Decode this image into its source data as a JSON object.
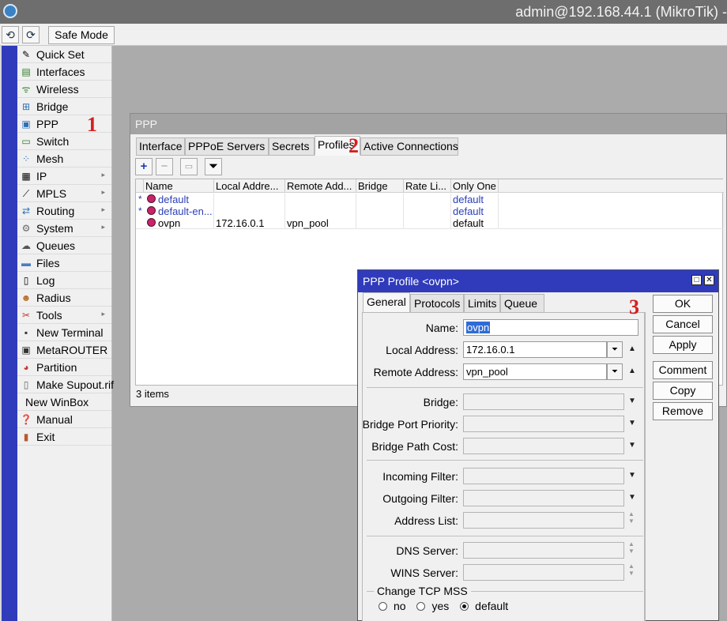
{
  "window": {
    "title": "admin@192.168.44.1 (MikroTik) -"
  },
  "toolbar": {
    "undo_icon": "undo-icon",
    "redo_icon": "redo-icon",
    "safe_mode": "Safe Mode"
  },
  "sidebar": {
    "items": [
      {
        "label": "Quick Set",
        "icon": "wand-icon"
      },
      {
        "label": "Interfaces",
        "icon": "interfaces-icon"
      },
      {
        "label": "Wireless",
        "icon": "wireless-icon"
      },
      {
        "label": "Bridge",
        "icon": "bridge-icon"
      },
      {
        "label": "PPP",
        "icon": "ppp-icon"
      },
      {
        "label": "Switch",
        "icon": "switch-icon"
      },
      {
        "label": "Mesh",
        "icon": "mesh-icon"
      },
      {
        "label": "IP",
        "icon": "ip-icon",
        "arrow": "▸"
      },
      {
        "label": "MPLS",
        "icon": "mpls-icon",
        "arrow": "▸"
      },
      {
        "label": "Routing",
        "icon": "routing-icon",
        "arrow": "▸"
      },
      {
        "label": "System",
        "icon": "gear-icon",
        "arrow": "▸"
      },
      {
        "label": "Queues",
        "icon": "queues-icon"
      },
      {
        "label": "Files",
        "icon": "folder-icon"
      },
      {
        "label": "Log",
        "icon": "log-icon"
      },
      {
        "label": "Radius",
        "icon": "radius-icon"
      },
      {
        "label": "Tools",
        "icon": "tools-icon",
        "arrow": "▸"
      },
      {
        "label": "New Terminal",
        "icon": "terminal-icon"
      },
      {
        "label": "MetaROUTER",
        "icon": "metarouter-icon"
      },
      {
        "label": "Partition",
        "icon": "partition-icon"
      },
      {
        "label": "Make Supout.rif",
        "icon": "document-icon"
      },
      {
        "label": "New WinBox",
        "icon": ""
      },
      {
        "label": "Manual",
        "icon": "help-icon"
      },
      {
        "label": "Exit",
        "icon": "exit-icon"
      }
    ]
  },
  "annotations": {
    "a1": "1",
    "a2": "2",
    "a3": "3"
  },
  "ppp": {
    "title": "PPP",
    "tabs": [
      "Interface",
      "PPPoE Servers",
      "Secrets",
      "Profiles",
      "Active Connections"
    ],
    "active_tab": "Profiles",
    "columns": [
      "Name",
      "Local Addre...",
      "Remote Add...",
      "Bridge",
      "Rate Li...",
      "Only One"
    ],
    "rows": [
      {
        "flag": "*",
        "name": "default",
        "local": "",
        "remote": "",
        "bridge": "",
        "rate": "",
        "only_one": "default",
        "default_style": true
      },
      {
        "flag": "*",
        "name": "default-en...",
        "local": "",
        "remote": "",
        "bridge": "",
        "rate": "",
        "only_one": "default",
        "default_style": true
      },
      {
        "flag": "",
        "name": "ovpn",
        "local": "172.16.0.1",
        "remote": "vpn_pool",
        "bridge": "",
        "rate": "",
        "only_one": "default",
        "default_style": false
      }
    ],
    "items_count": "3 items"
  },
  "dialog": {
    "title": "PPP Profile <ovpn>",
    "tabs": [
      "General",
      "Protocols",
      "Limits",
      "Queue"
    ],
    "active_tab": "General",
    "fields": {
      "name": {
        "label": "Name:",
        "value": "ovpn"
      },
      "local_address": {
        "label": "Local Address:",
        "value": "172.16.0.1"
      },
      "remote_address": {
        "label": "Remote Address:",
        "value": "vpn_pool"
      },
      "bridge": {
        "label": "Bridge:",
        "value": ""
      },
      "bridge_port_priority": {
        "label": "Bridge Port Priority:",
        "value": ""
      },
      "bridge_path_cost": {
        "label": "Bridge Path Cost:",
        "value": ""
      },
      "incoming_filter": {
        "label": "Incoming Filter:",
        "value": ""
      },
      "outgoing_filter": {
        "label": "Outgoing Filter:",
        "value": ""
      },
      "address_list": {
        "label": "Address List:",
        "value": ""
      },
      "dns_server": {
        "label": "DNS Server:",
        "value": ""
      },
      "wins_server": {
        "label": "WINS Server:",
        "value": ""
      }
    },
    "change_tcp_mss": {
      "label": "Change TCP MSS",
      "options": [
        "no",
        "yes",
        "default"
      ],
      "selected": "default"
    },
    "buttons": {
      "ok": "OK",
      "cancel": "Cancel",
      "apply": "Apply",
      "comment": "Comment",
      "copy": "Copy",
      "remove": "Remove"
    }
  },
  "colors": {
    "accent": "#2f3bbb",
    "annotation": "#d42020",
    "default_row": "#2a3fb8"
  }
}
